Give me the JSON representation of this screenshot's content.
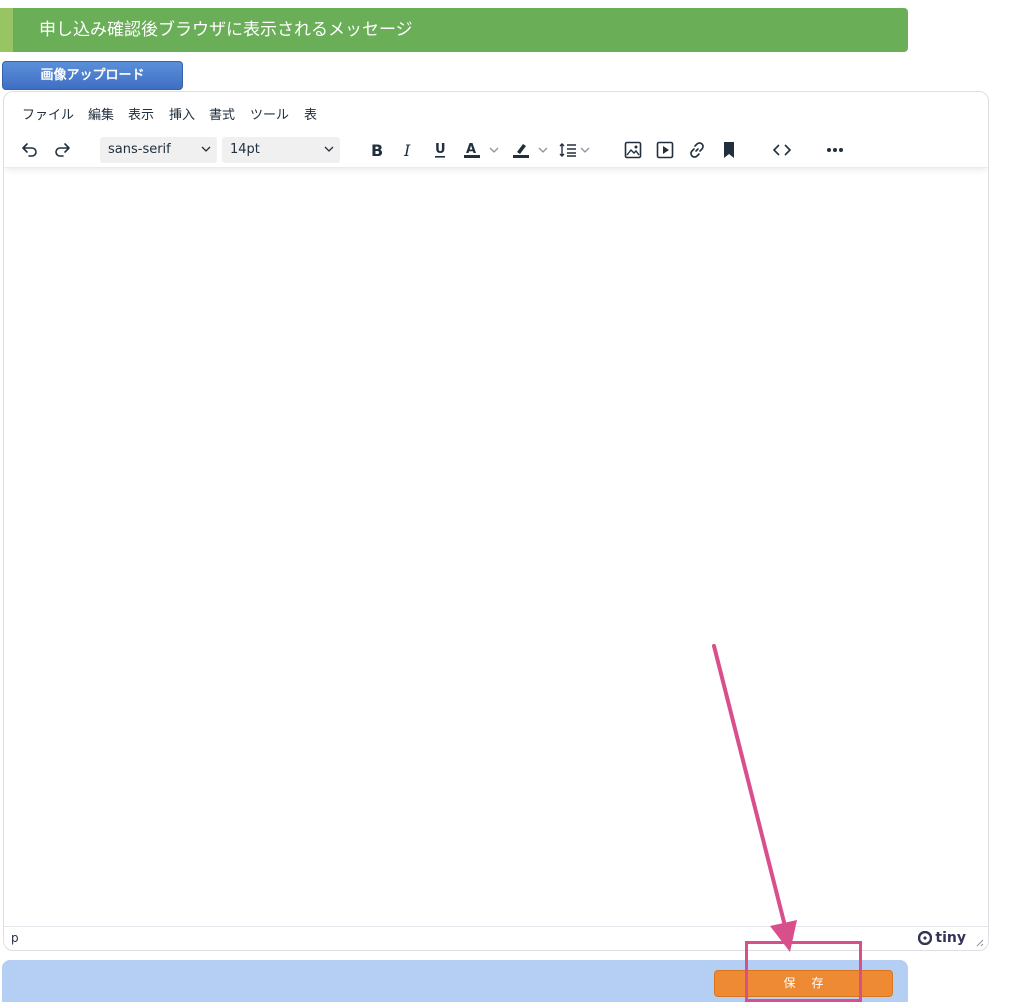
{
  "section_header": {
    "title": "申し込み確認後ブラウザに表示されるメッセージ"
  },
  "upload_button": {
    "label": "画像アップロード"
  },
  "menubar": {
    "items": [
      "ファイル",
      "編集",
      "表示",
      "挿入",
      "書式",
      "ツール",
      "表"
    ]
  },
  "toolbar": {
    "font_family": "sans-serif",
    "font_size": "14pt",
    "buttons": [
      "undo-icon",
      "redo-icon",
      "bold-icon",
      "italic-icon",
      "underline-icon",
      "text-color-icon",
      "highlight-icon",
      "line-height-icon",
      "image-icon",
      "media-icon",
      "link-icon",
      "bookmark-icon",
      "code-icon",
      "more-icon"
    ]
  },
  "statusbar": {
    "path": "p",
    "brand": "tiny"
  },
  "footer": {
    "save_label": "保存"
  },
  "colors": {
    "header_bg": "#6aae58",
    "upload_btn": "#3f6fc4",
    "footer_bg": "#b5cef3",
    "save_btn": "#ef8a34",
    "annotation": "#d94f8c"
  }
}
